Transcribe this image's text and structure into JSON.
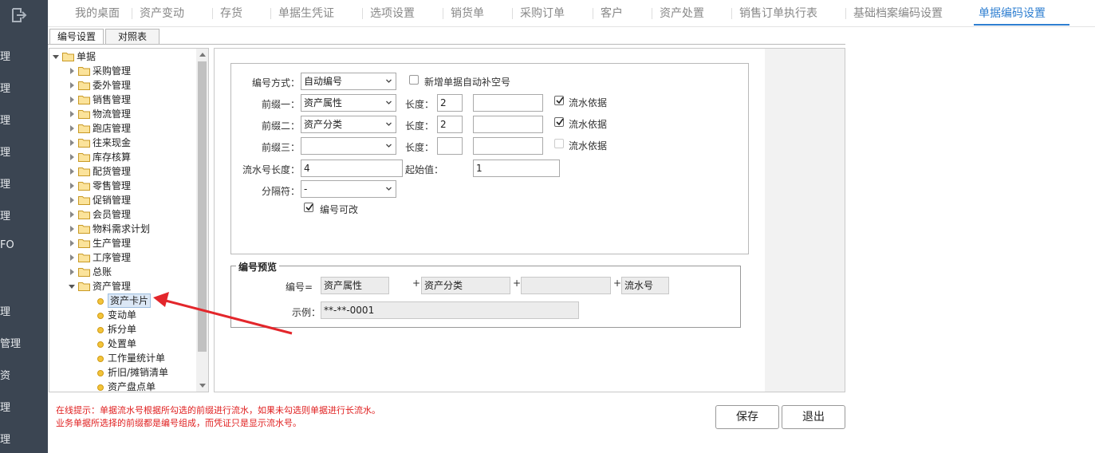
{
  "sidebar": {
    "items": [
      "理",
      "理",
      "理",
      "理",
      "理",
      "理",
      "FO",
      "理",
      "管理",
      "资",
      "理",
      "理"
    ]
  },
  "tabs": [
    {
      "label": "我的桌面"
    },
    {
      "label": "资产变动"
    },
    {
      "label": "存货"
    },
    {
      "label": "单据生凭证"
    },
    {
      "label": "选项设置"
    },
    {
      "label": "销货单"
    },
    {
      "label": "采购订单"
    },
    {
      "label": "客户"
    },
    {
      "label": "资产处置"
    },
    {
      "label": "销售订单执行表"
    },
    {
      "label": "基础档案编码设置"
    },
    {
      "label": "单据编码设置",
      "active": true
    }
  ],
  "subtabs": [
    "编号设置",
    "对照表"
  ],
  "tree": {
    "root": "单据",
    "groups": [
      "采购管理",
      "委外管理",
      "销售管理",
      "物流管理",
      "跑店管理",
      "往来现金",
      "库存核算",
      "配货管理",
      "零售管理",
      "促销管理",
      "会员管理",
      "物料需求计划",
      "生产管理",
      "工序管理",
      "总账"
    ],
    "expanded": "资产管理",
    "children": [
      "资产卡片",
      "变动单",
      "拆分单",
      "处置单",
      "工作量统计单",
      "折旧/摊销清单",
      "资产盘点单"
    ],
    "selected": "资产卡片"
  },
  "form": {
    "numbering_method_label": "编号方式：",
    "numbering_method_value": "自动编号",
    "auto_fill_label": "新增单据自动补空号",
    "auto_fill_checked": false,
    "prefix1_label": "前缀一：",
    "prefix1_value": "资产属性",
    "prefix2_label": "前缀二：",
    "prefix2_value": "资产分类",
    "prefix3_label": "前缀三：",
    "prefix3_value": "",
    "length_label": "长度：",
    "prefix1_length": "2",
    "prefix2_length": "2",
    "prefix3_length": "",
    "serial_basis_label": "流水依据",
    "serial_basis1_checked": true,
    "serial_basis2_checked": true,
    "serial_basis3_checked": false,
    "serial_length_label": "流水号长度：",
    "serial_length_value": "4",
    "start_value_label": "起始值：",
    "start_value": "1",
    "separator_label": "分隔符：",
    "separator_value": "-",
    "editable_label": "编号可改",
    "editable_checked": true
  },
  "preview": {
    "title": "编号预览",
    "number_label": "编号=",
    "part1": "资产属性",
    "part2": "资产分类",
    "part3": "",
    "part4": "流水号",
    "plus": "+",
    "example_label": "示例：",
    "example_value": "**-**-0001"
  },
  "hints": {
    "line1": "在线提示：单据流水号根据所勾选的前缀进行流水，如果未勾选则单据进行长流水。",
    "line2": "业务单据所选择的前缀都是编号组成，而凭证只是显示流水号。"
  },
  "buttons": {
    "save": "保存",
    "exit": "退出"
  },
  "colors": {
    "accent": "#2f7fd1",
    "sidebar_bg": "#3b4552",
    "hint": "#e02020",
    "arrow": "#e3262b"
  }
}
